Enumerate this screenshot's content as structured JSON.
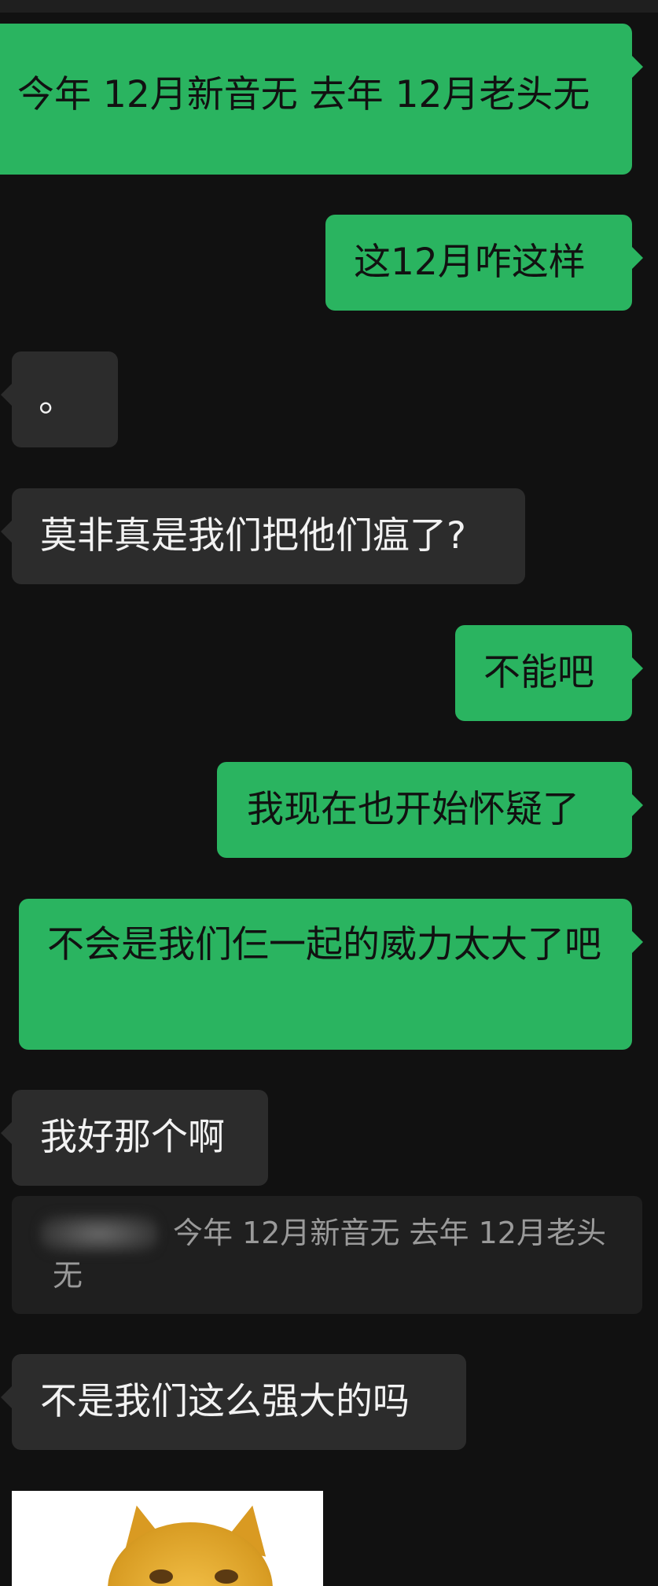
{
  "messages": [
    {
      "side": "sent",
      "text": "今年 12月新音无 去年 12月老头无"
    },
    {
      "side": "sent",
      "text": "这12月咋这样"
    },
    {
      "side": "recv",
      "text": "。"
    },
    {
      "side": "recv",
      "text": "莫非真是我们把他们瘟了?"
    },
    {
      "side": "sent",
      "text": "不能吧"
    },
    {
      "side": "sent",
      "text": "我现在也开始怀疑了"
    },
    {
      "side": "sent",
      "text": "不会是我们仨一起的威力太大了吧"
    },
    {
      "side": "recv",
      "text": "我好那个啊"
    },
    {
      "side": "recv",
      "text": "不是我们这么强大的吗"
    }
  ],
  "quote": {
    "line1": "今年 12月新音无 去年 12月老头",
    "line2": "无"
  },
  "colors": {
    "background": "#111111",
    "sent_bubble": "#2ab460",
    "received_bubble": "#2c2c2c",
    "quote_background": "#1f1f1f"
  }
}
